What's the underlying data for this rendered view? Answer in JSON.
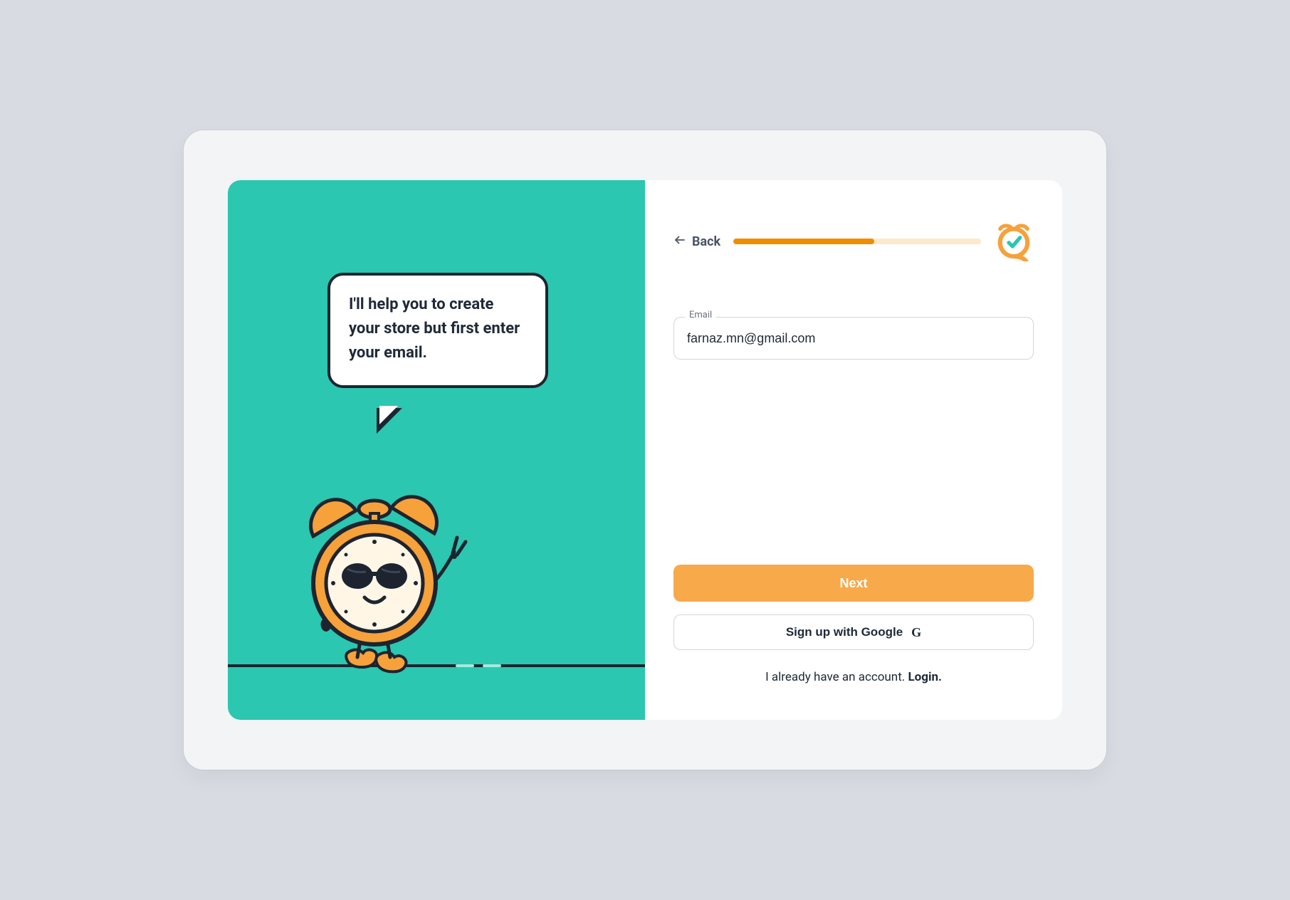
{
  "left": {
    "speech_text": "I'll help you to create your store but first enter your email."
  },
  "header": {
    "back_label": "Back",
    "progress_percent": 57
  },
  "form": {
    "email_label": "Email",
    "email_value": "farnaz.mn@gmail.com"
  },
  "actions": {
    "next_label": "Next",
    "google_label": "Sign up with Google",
    "existing_text": "I already have an account. ",
    "login_label": "Login."
  },
  "icons": {
    "back_arrow": "arrow-left-icon",
    "logo": "alarm-clock-check-logo",
    "google": "google-g-icon",
    "mascot": "alarm-clock-mascot-illustration"
  }
}
